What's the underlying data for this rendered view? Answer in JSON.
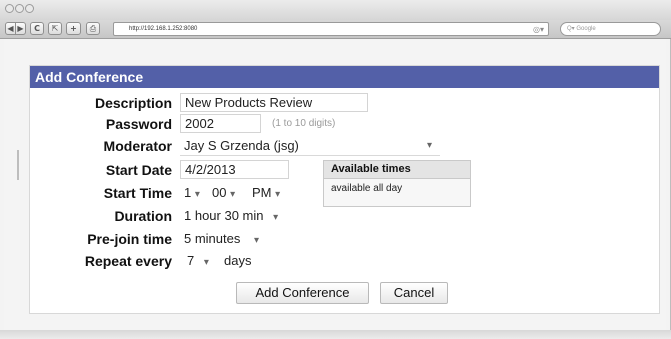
{
  "browser": {
    "url": "http://192.168.1.252:8080",
    "search_placeholder": "Google",
    "buttons": {
      "back": "◀",
      "forward": "▶",
      "reload": "C",
      "snapback": "⇱",
      "add_bookmark": "+",
      "print": "⎙"
    }
  },
  "form": {
    "title": "Add Conference",
    "description": {
      "label": "Description",
      "value": "New Products Review"
    },
    "password": {
      "label": "Password",
      "value": "2002",
      "hint": "(1 to 10 digits)"
    },
    "moderator": {
      "label": "Moderator",
      "value": "Jay S Grzenda (jsg)"
    },
    "start_date": {
      "label": "Start Date",
      "value": "4/2/2013"
    },
    "start_time": {
      "label": "Start Time",
      "hour": "1",
      "minute": "00",
      "ampm": "PM"
    },
    "duration": {
      "label": "Duration",
      "value": "1 hour 30 min"
    },
    "prejoin": {
      "label": "Pre-join time",
      "value": "5 minutes"
    },
    "repeat": {
      "label": "Repeat every",
      "value": "7",
      "unit": "days"
    },
    "available_times": {
      "title": "Available times",
      "text": "available all day"
    },
    "add_button": "Add Conference",
    "cancel_button": "Cancel"
  }
}
